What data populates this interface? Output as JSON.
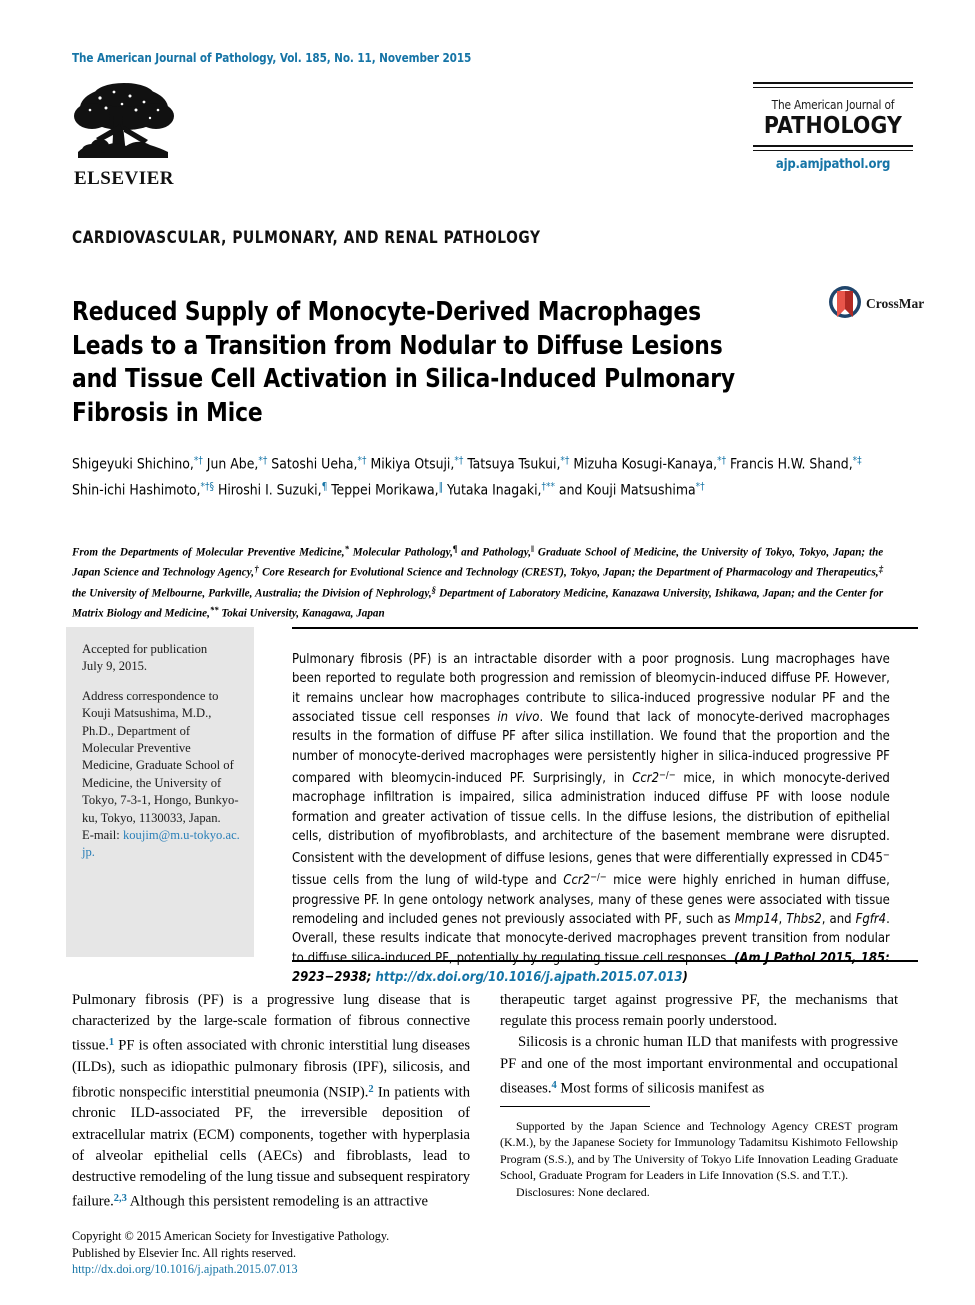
{
  "running_head": "The American Journal of Pathology, Vol. 185, No. 11, November 2015",
  "publisher": {
    "logo_name": "elsevier-tree-logo",
    "wordmark": "ELSEVIER"
  },
  "journal": {
    "name_small": "The American Journal of",
    "name_big": "PATHOLOGY",
    "url": "ajp.amjpathol.org"
  },
  "kicker": "CARDIOVASCULAR, PULMONARY, AND RENAL PATHOLOGY",
  "title": "Reduced Supply of Monocyte-Derived Macrophages Leads to a Transition from Nodular to Diffuse Lesions and Tissue Cell Activation in Silica-Induced Pulmonary Fibrosis in Mice",
  "crossmark": {
    "label": "CrossMark",
    "icon": "crossmark-badge-icon"
  },
  "authors_html": "Shigeyuki Shichino,<sup>*†</sup> Jun Abe,<sup>*†</sup> Satoshi Ueha,<sup>*†</sup> Mikiya Otsuji,<sup>*†</sup> Tatsuya Tsukui,<sup>*†</sup> Mizuha Kosugi-Kanaya,<sup>*†</sup> Francis H.W. Shand,<sup>*‡</sup> Shin-ichi Hashimoto,<sup>*†§</sup> Hiroshi I. Suzuki,<sup>¶</sup> Teppei Morikawa,<sup>‖</sup> Yutaka Inagaki,<sup>†**</sup> and Kouji Matsushima<sup>*†</sup>",
  "affiliations_html": "From the Departments of Molecular Preventive Medicine,<sup>*</sup> Molecular Pathology,<sup>¶</sup> and Pathology,<sup>‖</sup> Graduate School of Medicine, the University of Tokyo, Tokyo, Japan; the Japan Science and Technology Agency,<sup>†</sup> Core Research for Evolutional Science and Technology (CREST), Tokyo, Japan; the Department of Pharmacology and Therapeutics,<sup>‡</sup> the University of Melbourne, Parkville, Australia; the Division of Nephrology,<sup>§</sup> Department of Laboratory Medicine, Kanazawa University, Ishikawa, Japan; and the Center for Matrix Biology and Medicine,<sup>**</sup> Tokai University, Kanagawa, Japan",
  "sidebar": {
    "accepted_label": "Accepted for publication",
    "accepted_date": "July 9, 2015.",
    "correspondence": "Address correspondence to Kouji Matsushima, M.D., Ph.D., Department of Molecular Preventive Medicine, Graduate School of Medicine, the University of Tokyo, 7-3-1, Hongo, Bunkyo-ku, Tokyo, 1130033, Japan.",
    "email_label": "E-mail:",
    "email": "koujim@m.u-tokyo.ac.jp."
  },
  "abstract_html": "Pulmonary fibrosis (PF) is an intractable disorder with a poor prognosis. Lung macrophages have been reported to regulate both progression and remission of bleomycin-induced diffuse PF. However, it remains unclear how macrophages contribute to silica-induced progressive nodular PF and the associated tissue cell responses <i>in vivo</i>. We found that lack of monocyte-derived macrophages results in the formation of diffuse PF after silica instillation. We found that the proportion and the number of monocyte-derived macrophages were persistently higher in silica-induced progressive PF compared with bleomycin-induced PF. Surprisingly, in <i>Ccr2</i><sup>&minus;/&minus;</sup> mice, in which monocyte-derived macrophage infiltration is impaired, silica administration induced diffuse PF with loose nodule formation and greater activation of tissue cells. In the diffuse lesions, the distribution of epithelial cells, distribution of myofibroblasts, and architecture of the basement membrane were disrupted. Consistent with the development of diffuse lesions, genes that were differentially expressed in CD45<sup>&minus;</sup> tissue cells from the lung of wild-type and <i>Ccr2</i><sup>&minus;/&minus;</sup> mice were highly enriched in human diffuse, progressive PF. In gene ontology network analyses, many of these genes were associated with tissue remodeling and included genes not previously associated with PF, such as <i>Mmp14</i>, <i>Thbs2</i>, and <i>Fgfr4</i>. Overall, these results indicate that monocyte-derived macrophages prevent transition from nodular to diffuse silica-induced PF, potentially by regulating tissue cell responses. <span class=\"cite\">(Am J Pathol 2015, 185: 2923&minus;2938; <span class=\"doi\">http://dx.doi.org/10.1016/j.ajpath.2015.07.013</span>)</span>",
  "body": {
    "left_column_html": "Pulmonary fibrosis (PF) is a progressive lung disease that is characterized by the large-scale formation of fibrous connective tissue.<sup>1</sup> PF is often associated with chronic interstitial lung diseases (ILDs), such as idiopathic pulmonary fibrosis (IPF), silicosis, and fibrotic nonspecific interstitial pneumonia (NSIP).<sup>2</sup> In patients with chronic ILD-associated PF, the irreversible deposition of extracellular matrix (ECM) components, together with hyperplasia of alveolar epithelial cells (AECs) and fibroblasts, lead to destructive remodeling of the lung tissue and subsequent respiratory failure.<sup>2,3</sup> Although this persistent remodeling is an attractive",
    "right_column_p1_html": "therapeutic target against progressive PF, the mechanisms that regulate this process remain poorly understood.",
    "right_column_p2_html": "Silicosis is a chronic human ILD that manifests with progressive PF and one of the most important environmental and occupational diseases.<sup>4</sup> Most forms of silicosis manifest as"
  },
  "footnotes": {
    "support": "Supported by the Japan Science and Technology Agency CREST program (K.M.), by the Japanese Society for Immunology Tadamitsu Kishimoto Fellowship Program (S.S.), and by The University of Tokyo Life Innovation Leading Graduate School, Graduate Program for Leaders in Life Innovation (S.S. and T.T.).",
    "disclosures": "Disclosures: None declared."
  },
  "copyright": {
    "line1": "Copyright © 2015 American Society for Investigative Pathology.",
    "line2": "Published by Elsevier Inc. All rights reserved.",
    "doi": "http://dx.doi.org/10.1016/j.ajpath.2015.07.013"
  },
  "colors": {
    "accent_blue": "#1574a6",
    "link_blue": "#2a7fb8",
    "sidebar_gray": "#e6e6e6"
  }
}
